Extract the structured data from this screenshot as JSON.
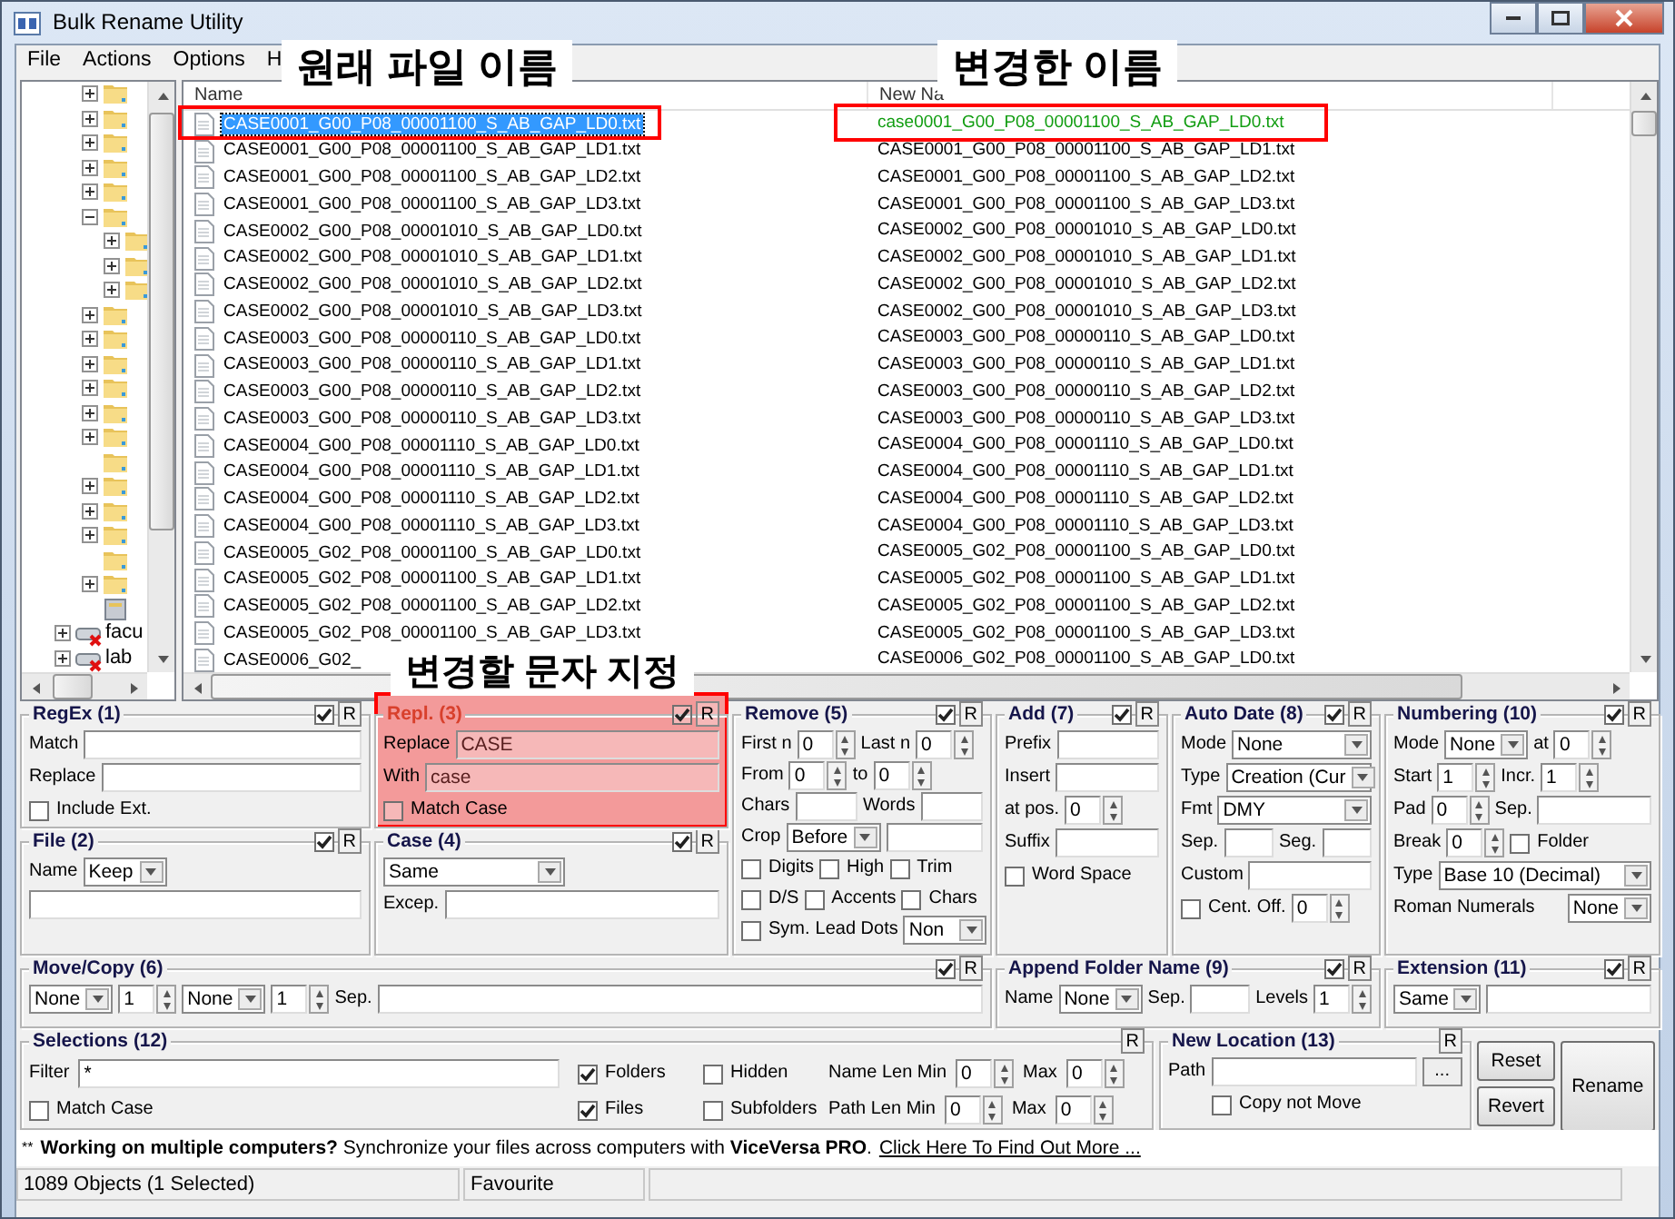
{
  "window": {
    "title": "Bulk Rename Utility"
  },
  "menu": [
    "File",
    "Actions",
    "Options",
    "H"
  ],
  "tree": [
    {
      "kind": "folder",
      "expanded": false
    },
    {
      "kind": "folder",
      "expanded": false
    },
    {
      "kind": "folder",
      "expanded": false
    },
    {
      "kind": "folder",
      "expanded": false
    },
    {
      "kind": "folder",
      "expanded": false
    },
    {
      "kind": "folder",
      "expanded": true,
      "children": [
        {
          "kind": "folder",
          "expanded": false
        },
        {
          "kind": "folder",
          "expanded": false
        },
        {
          "kind": "folder",
          "expanded": false
        }
      ]
    },
    {
      "kind": "folder",
      "expanded": false
    },
    {
      "kind": "folder",
      "expanded": false
    },
    {
      "kind": "folder",
      "expanded": false
    },
    {
      "kind": "folder",
      "expanded": false
    },
    {
      "kind": "folder",
      "expanded": false
    },
    {
      "kind": "folder",
      "expanded": false
    },
    {
      "kind": "folder"
    },
    {
      "kind": "folder",
      "expanded": false
    },
    {
      "kind": "folder",
      "expanded": false
    },
    {
      "kind": "folder",
      "expanded": false
    },
    {
      "kind": "folder"
    },
    {
      "kind": "folder",
      "expanded": false
    },
    {
      "kind": "cabinet"
    },
    {
      "kind": "drive",
      "expanded": false,
      "label": "facu"
    },
    {
      "kind": "drive",
      "expanded": false,
      "label": "lab"
    }
  ],
  "columns": [
    "Name",
    "New Na"
  ],
  "files": [
    {
      "name": "CASE0001_G00_P08_00001100_S_AB_GAP_LD0.txt",
      "new_name": "case0001_G00_P08_00001100_S_AB_GAP_LD0.txt",
      "selected": true,
      "changed": true
    },
    {
      "name": "CASE0001_G00_P08_00001100_S_AB_GAP_LD1.txt",
      "new_name": "CASE0001_G00_P08_00001100_S_AB_GAP_LD1.txt",
      "selected": false,
      "changed": false
    },
    {
      "name": "CASE0001_G00_P08_00001100_S_AB_GAP_LD2.txt",
      "new_name": "CASE0001_G00_P08_00001100_S_AB_GAP_LD2.txt",
      "selected": false,
      "changed": false
    },
    {
      "name": "CASE0001_G00_P08_00001100_S_AB_GAP_LD3.txt",
      "new_name": "CASE0001_G00_P08_00001100_S_AB_GAP_LD3.txt",
      "selected": false,
      "changed": false
    },
    {
      "name": "CASE0002_G00_P08_00001010_S_AB_GAP_LD0.txt",
      "new_name": "CASE0002_G00_P08_00001010_S_AB_GAP_LD0.txt",
      "selected": false,
      "changed": false
    },
    {
      "name": "CASE0002_G00_P08_00001010_S_AB_GAP_LD1.txt",
      "new_name": "CASE0002_G00_P08_00001010_S_AB_GAP_LD1.txt",
      "selected": false,
      "changed": false
    },
    {
      "name": "CASE0002_G00_P08_00001010_S_AB_GAP_LD2.txt",
      "new_name": "CASE0002_G00_P08_00001010_S_AB_GAP_LD2.txt",
      "selected": false,
      "changed": false
    },
    {
      "name": "CASE0002_G00_P08_00001010_S_AB_GAP_LD3.txt",
      "new_name": "CASE0002_G00_P08_00001010_S_AB_GAP_LD3.txt",
      "selected": false,
      "changed": false
    },
    {
      "name": "CASE0003_G00_P08_00000110_S_AB_GAP_LD0.txt",
      "new_name": "CASE0003_G00_P08_00000110_S_AB_GAP_LD0.txt",
      "selected": false,
      "changed": false
    },
    {
      "name": "CASE0003_G00_P08_00000110_S_AB_GAP_LD1.txt",
      "new_name": "CASE0003_G00_P08_00000110_S_AB_GAP_LD1.txt",
      "selected": false,
      "changed": false
    },
    {
      "name": "CASE0003_G00_P08_00000110_S_AB_GAP_LD2.txt",
      "new_name": "CASE0003_G00_P08_00000110_S_AB_GAP_LD2.txt",
      "selected": false,
      "changed": false
    },
    {
      "name": "CASE0003_G00_P08_00000110_S_AB_GAP_LD3.txt",
      "new_name": "CASE0003_G00_P08_00000110_S_AB_GAP_LD3.txt",
      "selected": false,
      "changed": false
    },
    {
      "name": "CASE0004_G00_P08_00001110_S_AB_GAP_LD0.txt",
      "new_name": "CASE0004_G00_P08_00001110_S_AB_GAP_LD0.txt",
      "selected": false,
      "changed": false
    },
    {
      "name": "CASE0004_G00_P08_00001110_S_AB_GAP_LD1.txt",
      "new_name": "CASE0004_G00_P08_00001110_S_AB_GAP_LD1.txt",
      "selected": false,
      "changed": false
    },
    {
      "name": "CASE0004_G00_P08_00001110_S_AB_GAP_LD2.txt",
      "new_name": "CASE0004_G00_P08_00001110_S_AB_GAP_LD2.txt",
      "selected": false,
      "changed": false
    },
    {
      "name": "CASE0004_G00_P08_00001110_S_AB_GAP_LD3.txt",
      "new_name": "CASE0004_G00_P08_00001110_S_AB_GAP_LD3.txt",
      "selected": false,
      "changed": false
    },
    {
      "name": "CASE0005_G02_P08_00001100_S_AB_GAP_LD0.txt",
      "new_name": "CASE0005_G02_P08_00001100_S_AB_GAP_LD0.txt",
      "selected": false,
      "changed": false
    },
    {
      "name": "CASE0005_G02_P08_00001100_S_AB_GAP_LD1.txt",
      "new_name": "CASE0005_G02_P08_00001100_S_AB_GAP_LD1.txt",
      "selected": false,
      "changed": false
    },
    {
      "name": "CASE0005_G02_P08_00001100_S_AB_GAP_LD2.txt",
      "new_name": "CASE0005_G02_P08_00001100_S_AB_GAP_LD2.txt",
      "selected": false,
      "changed": false
    },
    {
      "name": "CASE0005_G02_P08_00001100_S_AB_GAP_LD3.txt",
      "new_name": "CASE0005_G02_P08_00001100_S_AB_GAP_LD3.txt",
      "selected": false,
      "changed": false
    },
    {
      "name": "CASE0006_G02_",
      "new_name": "CASE0006_G02_P08_00001100_S_AB_GAP_LD0.txt",
      "selected": false,
      "changed": false
    }
  ],
  "panels": [
    {
      "title": "RegEx (1)",
      "enabled": true,
      "reset": "R",
      "rows": [
        [
          {
            "kind": "label",
            "text": "Match"
          },
          {
            "kind": "field"
          }
        ],
        [
          {
            "kind": "label",
            "text": "Replace"
          },
          {
            "kind": "field"
          }
        ],
        [
          {
            "kind": "check",
            "label": "Include Ext.",
            "checked": false
          }
        ]
      ]
    },
    {
      "title": "File (2)",
      "enabled": true,
      "reset": "R",
      "rows": [
        [
          {
            "kind": "label",
            "text": "Name"
          },
          {
            "kind": "select",
            "value": "Keep"
          }
        ],
        [
          {
            "kind": "field"
          }
        ]
      ]
    },
    {
      "title": "Repl. (3)",
      "enabled": true,
      "reset": "R",
      "rows": [
        [
          {
            "kind": "label",
            "text": "Replace"
          },
          {
            "kind": "field",
            "value": "CASE"
          }
        ],
        [
          {
            "kind": "label",
            "text": "With"
          },
          {
            "kind": "field",
            "value": "case"
          }
        ],
        [
          {
            "kind": "check",
            "label": "Match Case",
            "checked": false
          }
        ]
      ]
    },
    {
      "title": "Case (4)",
      "enabled": true,
      "reset": "R",
      "rows": [
        [
          {
            "kind": "select",
            "value": "Same"
          }
        ],
        [
          {
            "kind": "label",
            "text": "Excep."
          },
          {
            "kind": "field"
          }
        ]
      ]
    },
    {
      "title": "Remove (5)",
      "enabled": true,
      "reset": "R",
      "rows": [
        [
          {
            "kind": "label",
            "text": "First n"
          },
          {
            "kind": "spin",
            "value": "0"
          },
          {
            "kind": "label",
            "text": "Last n"
          },
          {
            "kind": "spin",
            "value": "0"
          }
        ],
        [
          {
            "kind": "label",
            "text": "From"
          },
          {
            "kind": "spin",
            "value": "0"
          },
          {
            "kind": "label",
            "text": "to"
          },
          {
            "kind": "spin",
            "value": "0"
          }
        ],
        [
          {
            "kind": "label",
            "text": "Chars"
          },
          {
            "kind": "field"
          },
          {
            "kind": "label",
            "text": "Words"
          },
          {
            "kind": "field"
          }
        ],
        [
          {
            "kind": "label",
            "text": "Crop"
          },
          {
            "kind": "select",
            "value": "Before"
          },
          {
            "kind": "field"
          }
        ],
        [
          {
            "kind": "check",
            "label": "Digits",
            "checked": false
          },
          {
            "kind": "check",
            "label": "High",
            "checked": false
          },
          {
            "kind": "check",
            "label": "Trim",
            "checked": false
          }
        ],
        [
          {
            "kind": "check",
            "label": "D/S",
            "checked": false
          },
          {
            "kind": "check",
            "label": "Accents",
            "checked": false
          },
          {
            "kind": "check",
            "label": "Chars",
            "checked": false
          }
        ],
        [
          {
            "kind": "check",
            "label": "Sym.",
            "checked": false
          },
          {
            "kind": "label",
            "text": "Lead Dots"
          },
          {
            "kind": "select",
            "value": "Non"
          }
        ]
      ]
    },
    {
      "title": "Move/Copy (6)",
      "enabled": true,
      "reset": "R",
      "rows": [
        [
          {
            "kind": "select",
            "value": "None"
          },
          {
            "kind": "spin",
            "value": "1"
          },
          {
            "kind": "select",
            "value": "None"
          },
          {
            "kind": "spin",
            "value": "1"
          },
          {
            "kind": "label",
            "text": "Sep."
          },
          {
            "kind": "field"
          }
        ]
      ]
    },
    {
      "title": "Add (7)",
      "enabled": true,
      "reset": "R",
      "rows": [
        [
          {
            "kind": "label",
            "text": "Prefix"
          },
          {
            "kind": "field"
          }
        ],
        [
          {
            "kind": "label",
            "text": "Insert"
          },
          {
            "kind": "field"
          }
        ],
        [
          {
            "kind": "label",
            "text": "at pos."
          },
          {
            "kind": "spin",
            "value": "0"
          }
        ],
        [
          {
            "kind": "label",
            "text": "Suffix"
          },
          {
            "kind": "field"
          }
        ],
        [
          {
            "kind": "check",
            "label": "Word Space",
            "checked": false
          }
        ]
      ]
    },
    {
      "title": "Auto Date (8)",
      "enabled": true,
      "reset": "R",
      "rows": [
        [
          {
            "kind": "label",
            "text": "Mode"
          },
          {
            "kind": "select",
            "value": "None"
          }
        ],
        [
          {
            "kind": "label",
            "text": "Type"
          },
          {
            "kind": "select",
            "value": "Creation (Cur"
          }
        ],
        [
          {
            "kind": "label",
            "text": "Fmt"
          },
          {
            "kind": "select",
            "value": "DMY"
          }
        ],
        [
          {
            "kind": "label",
            "text": "Sep."
          },
          {
            "kind": "field"
          },
          {
            "kind": "label",
            "text": "Seg."
          },
          {
            "kind": "field"
          }
        ],
        [
          {
            "kind": "label",
            "text": "Custom"
          },
          {
            "kind": "field"
          }
        ],
        [
          {
            "kind": "check",
            "label": "Cent.",
            "checked": false
          },
          {
            "kind": "label",
            "text": "Off."
          },
          {
            "kind": "spin",
            "value": "0"
          }
        ]
      ]
    },
    {
      "title": "Append Folder Name (9)",
      "enabled": true,
      "reset": "R",
      "rows": [
        [
          {
            "kind": "label",
            "text": "Name"
          },
          {
            "kind": "select",
            "value": "None"
          },
          {
            "kind": "label",
            "text": "Sep."
          },
          {
            "kind": "field"
          },
          {
            "kind": "label",
            "text": "Levels"
          },
          {
            "kind": "spin",
            "value": "1"
          }
        ]
      ]
    },
    {
      "title": "Numbering (10)",
      "enabled": true,
      "reset": "R",
      "rows": [
        [
          {
            "kind": "label",
            "text": "Mode"
          },
          {
            "kind": "select",
            "value": "None"
          },
          {
            "kind": "label",
            "text": "at"
          },
          {
            "kind": "spin",
            "value": "0"
          }
        ],
        [
          {
            "kind": "label",
            "text": "Start"
          },
          {
            "kind": "spin",
            "value": "1"
          },
          {
            "kind": "label",
            "text": "Incr."
          },
          {
            "kind": "spin",
            "value": "1"
          }
        ],
        [
          {
            "kind": "label",
            "text": "Pad"
          },
          {
            "kind": "spin",
            "value": "0"
          },
          {
            "kind": "label",
            "text": "Sep."
          },
          {
            "kind": "field"
          }
        ],
        [
          {
            "kind": "label",
            "text": "Break"
          },
          {
            "kind": "spin",
            "value": "0"
          },
          {
            "kind": "check",
            "label": "Folder",
            "checked": false
          }
        ],
        [
          {
            "kind": "label",
            "text": "Type"
          },
          {
            "kind": "select",
            "value": "Base 10 (Decimal)"
          }
        ],
        [
          {
            "kind": "label",
            "text": "Roman Numerals"
          },
          {
            "kind": "select",
            "value": "None"
          }
        ]
      ]
    },
    {
      "title": "Extension (11)",
      "enabled": true,
      "reset": "R",
      "rows": [
        [
          {
            "kind": "select",
            "value": "Same"
          },
          {
            "kind": "field"
          }
        ]
      ]
    },
    {
      "title": "Selections (12)",
      "reset": "R",
      "rows": [
        [
          {
            "kind": "label",
            "text": "Filter"
          },
          {
            "kind": "field",
            "value": "*"
          }
        ],
        [
          {
            "kind": "check",
            "label": "Folders",
            "checked": true
          },
          {
            "kind": "check",
            "label": "Hidden",
            "checked": false
          },
          {
            "kind": "label",
            "text": "Name Len Min"
          },
          {
            "kind": "spin",
            "value": "0"
          },
          {
            "kind": "label",
            "text": "Max"
          },
          {
            "kind": "spin",
            "value": "0"
          }
        ],
        [
          {
            "kind": "check",
            "label": "Match Case",
            "checked": false
          }
        ],
        [
          {
            "kind": "check",
            "label": "Files",
            "checked": true
          },
          {
            "kind": "check",
            "label": "Subfolders",
            "checked": false
          },
          {
            "kind": "label",
            "text": "Path Len Min"
          },
          {
            "kind": "spin",
            "value": "0"
          },
          {
            "kind": "label",
            "text": "Max"
          },
          {
            "kind": "spin",
            "value": "0"
          }
        ]
      ]
    },
    {
      "title": "New Location (13)",
      "reset": "R",
      "rows": [
        [
          {
            "kind": "label",
            "text": "Path"
          },
          {
            "kind": "field"
          },
          {
            "kind": "button",
            "label": "..."
          }
        ],
        [
          {
            "kind": "check",
            "label": "Copy not Move",
            "checked": false
          }
        ]
      ]
    }
  ],
  "buttons": [
    "Reset",
    "Revert",
    "Rename"
  ],
  "promo": {
    "prefix": "**",
    "text": "**Working on multiple computers?** Synchronize your files across computers with **ViceVersa PRO**.",
    "link": "Click Here To Find Out More ..."
  },
  "status_bar": [
    "1089 Objects (1 Selected)",
    "Favourite"
  ],
  "annotations": [
    {
      "kind": "frame"
    },
    {
      "kind": "frame"
    },
    {
      "kind": "shade"
    },
    {
      "kind": "label",
      "text": "원래 파일 이름"
    },
    {
      "kind": "label",
      "text": "변경한 이름"
    },
    {
      "kind": "label",
      "text": "변경할 문자 지정"
    }
  ]
}
